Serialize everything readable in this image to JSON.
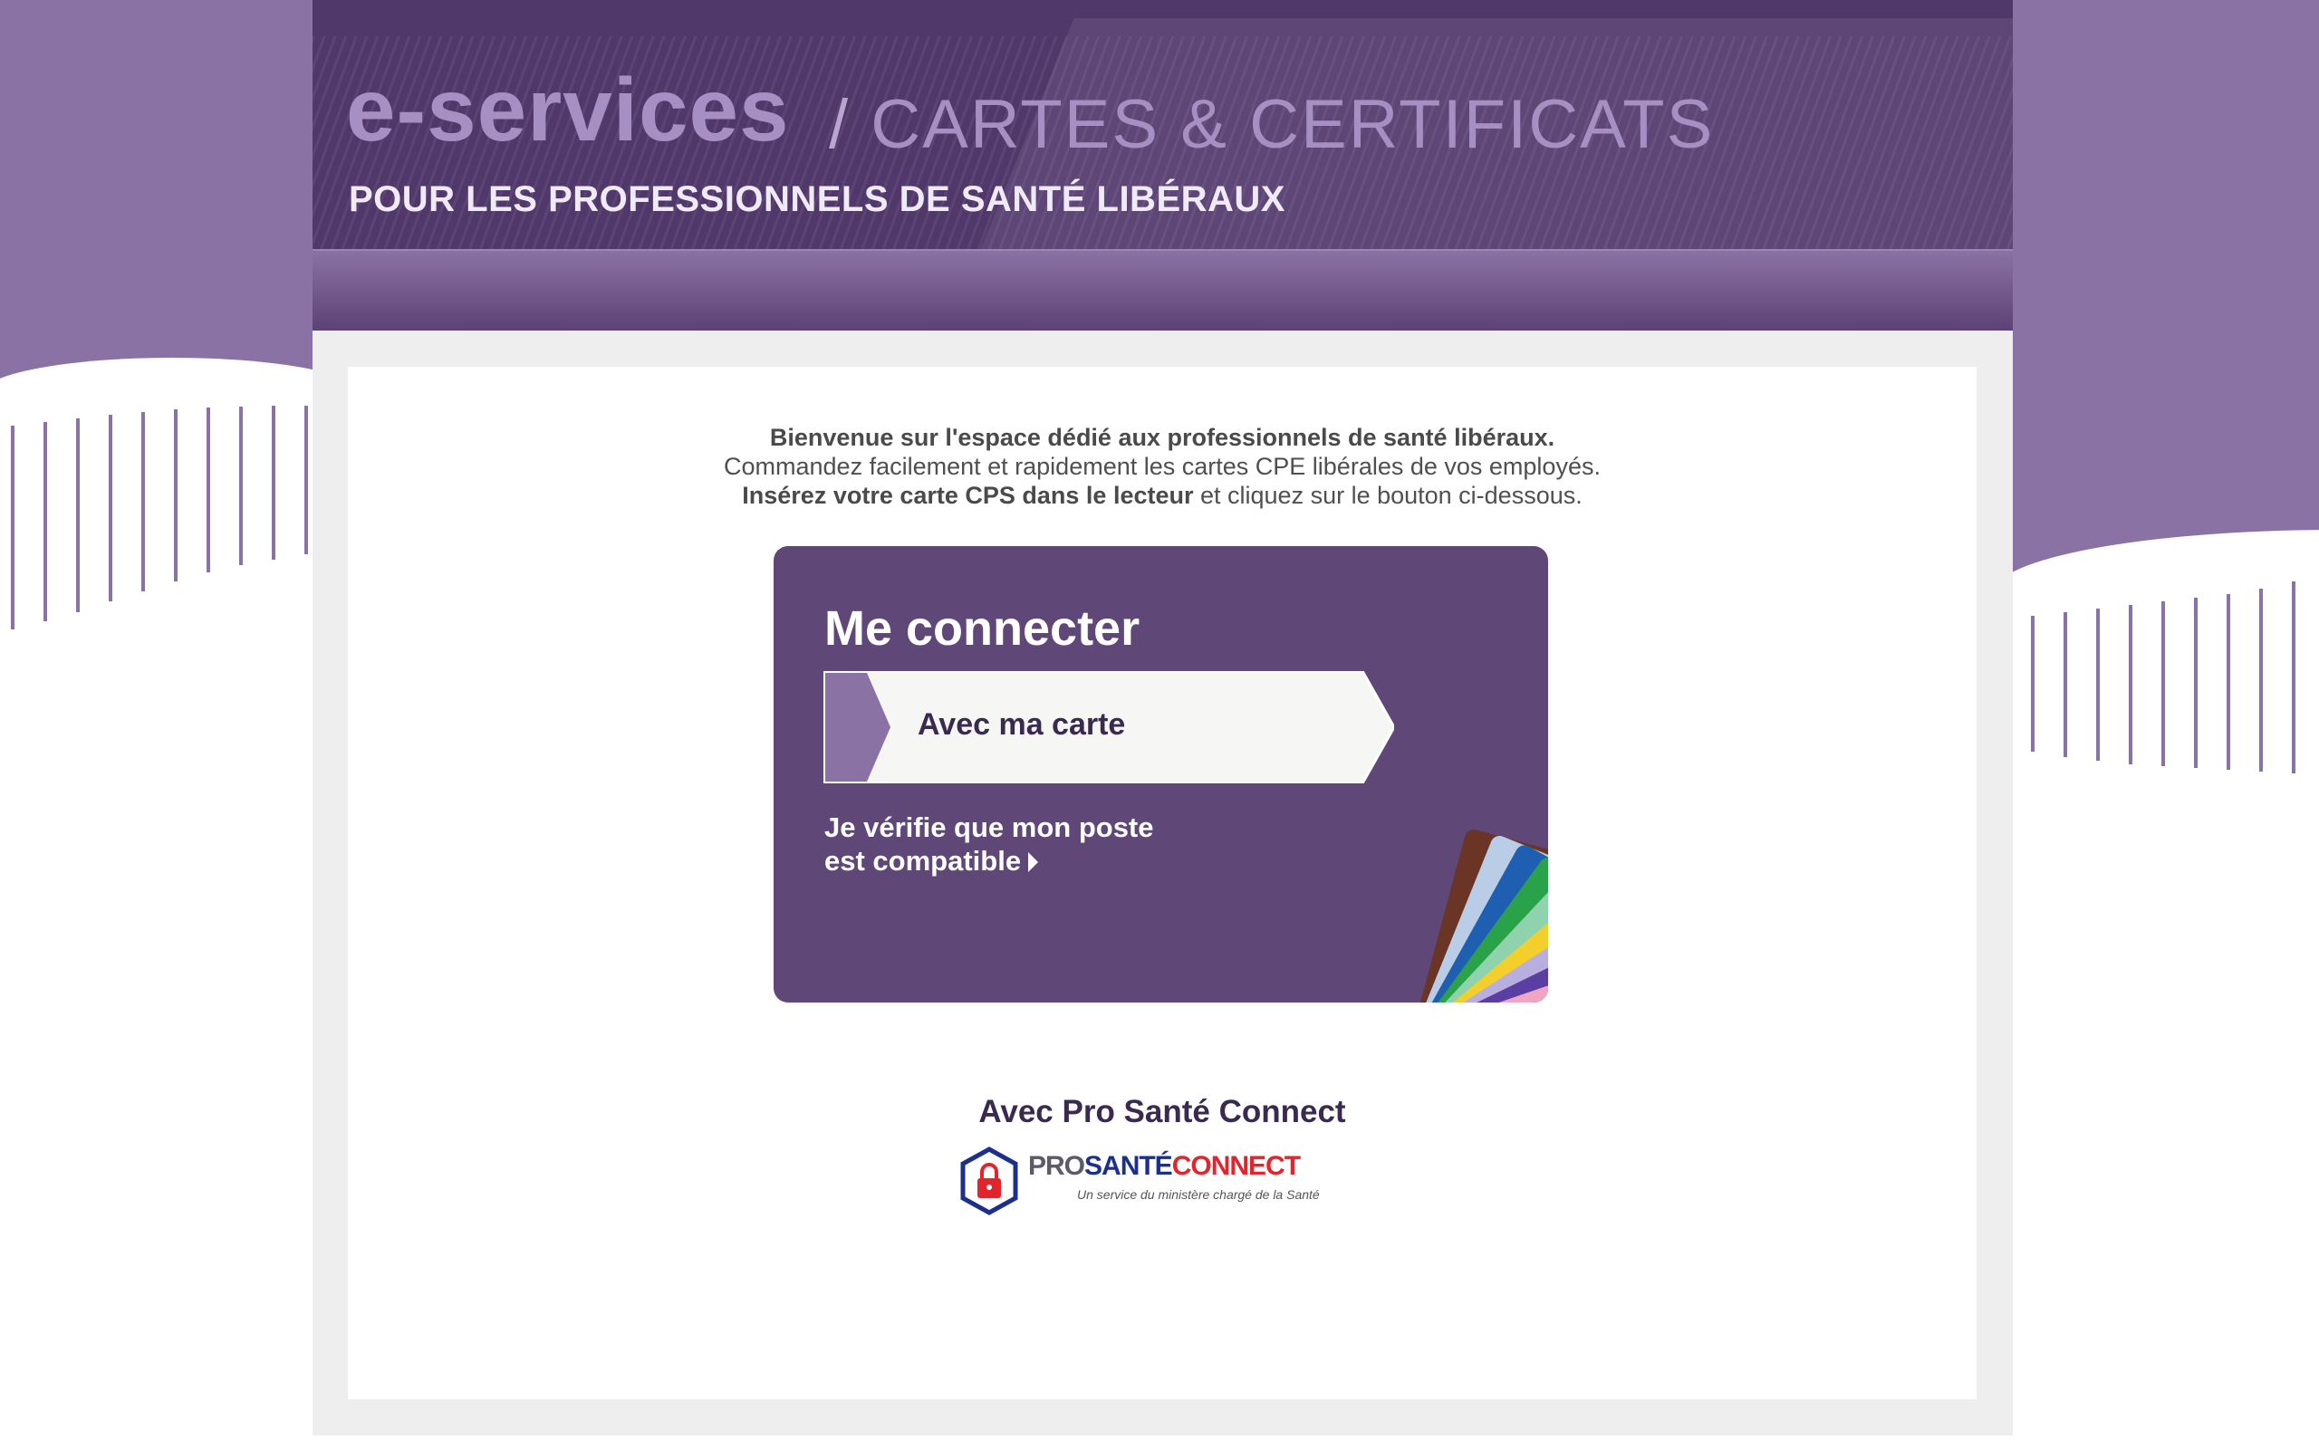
{
  "header": {
    "eservices": "e-services",
    "slash": "/",
    "subtitle": "CARTES & CERTIFICATS",
    "tagline": "POUR LES PROFESSIONNELS DE SANTÉ LIBÉRAUX"
  },
  "intro": {
    "line1": "Bienvenue sur l'espace dédié aux professionnels de santé libéraux.",
    "line2": "Commandez facilement et rapidement les cartes CPE libérales de vos employés.",
    "line3_bold": "Insérez votre carte CPS dans le lecteur",
    "line3_rest": " et cliquez sur le bouton ci-dessous."
  },
  "login_card": {
    "title": "Me connecter",
    "button_label": "Avec ma carte",
    "compat_line1": "Je vérifie que mon poste",
    "compat_line2": "est compatible"
  },
  "psc": {
    "title": "Avec Pro Santé Connect",
    "logo_pro": "PRO",
    "logo_sante": "SANTÉ",
    "logo_connect": "CONNECT",
    "logo_small": "Un service du ministère chargé de la Santé"
  },
  "colors": {
    "brand_purple": "#51386a",
    "light_purple": "#8b72a5",
    "card_purple": "#5f4878"
  }
}
